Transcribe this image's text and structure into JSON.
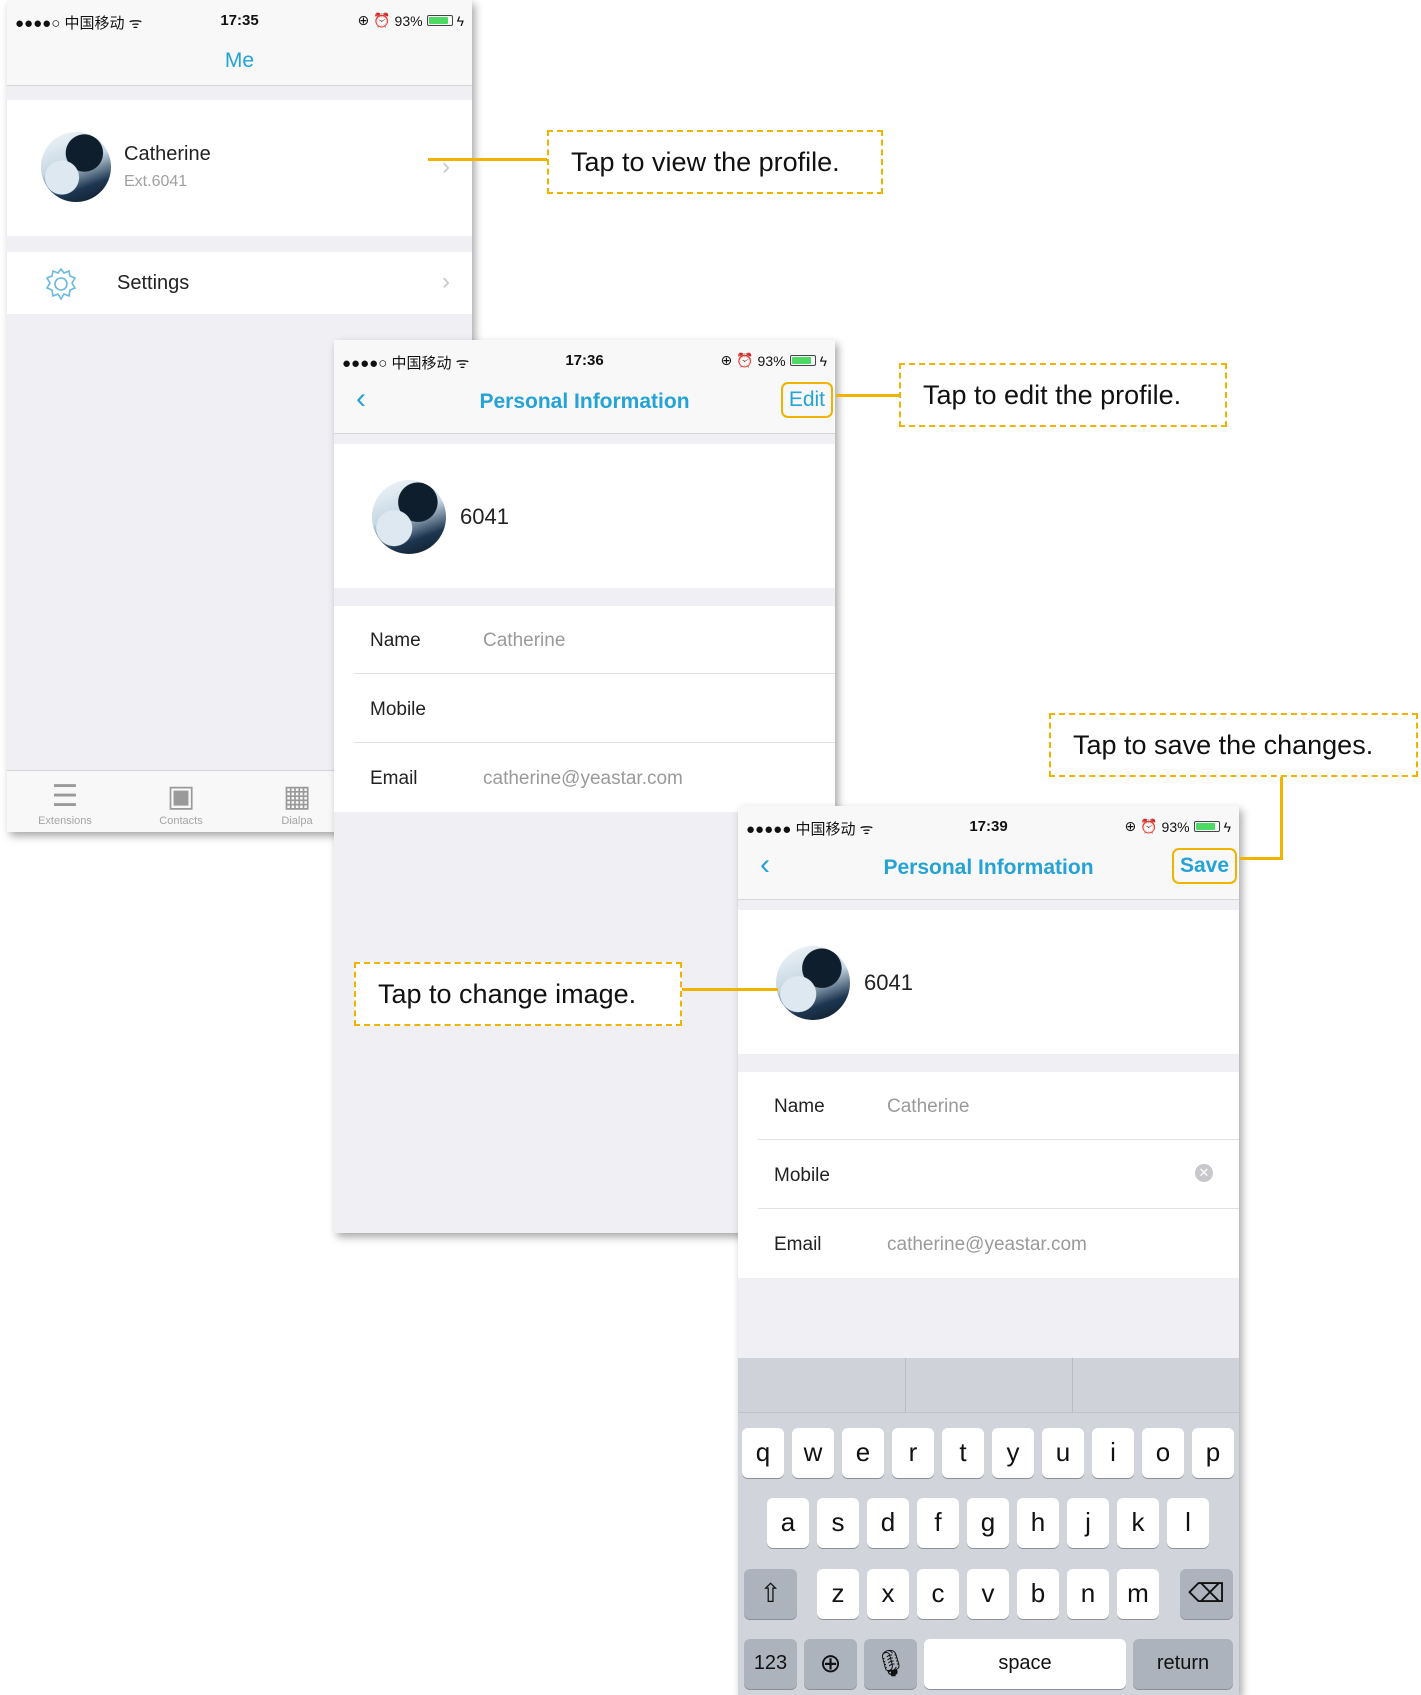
{
  "screen1": {
    "status": {
      "carrier": "●●●●○ 中国移动 ᯤ",
      "time": "17:35",
      "icons": "⊕ ⏰",
      "battery": "93%"
    },
    "title": "Me",
    "profile": {
      "name": "Catherine",
      "ext": "Ext.6041"
    },
    "settings_label": "Settings",
    "tabs": [
      {
        "label": "Extensions",
        "icon": "list-icon"
      },
      {
        "label": "Contacts",
        "icon": "contacts-icon"
      },
      {
        "label": "Dialpa",
        "icon": "dialpad-icon"
      }
    ]
  },
  "screen2": {
    "status": {
      "carrier": "●●●●○ 中国移动 ᯤ",
      "time": "17:36",
      "icons": "⊕ ⏰",
      "battery": "93%"
    },
    "title": "Personal Information",
    "action": "Edit",
    "extension": "6041",
    "fields": [
      {
        "label": "Name",
        "value": "Catherine"
      },
      {
        "label": "Mobile",
        "value": ""
      },
      {
        "label": "Email",
        "value": "catherine@yeastar.com"
      }
    ]
  },
  "screen3": {
    "status": {
      "carrier": "●●●●● 中国移动 ᯤ",
      "time": "17:39",
      "icons": "⊕ ⏰",
      "battery": "93%"
    },
    "title": "Personal Information",
    "action": "Save",
    "extension": "6041",
    "fields": [
      {
        "label": "Name",
        "value": "Catherine"
      },
      {
        "label": "Mobile",
        "value": ""
      },
      {
        "label": "Email",
        "value": "catherine@yeastar.com"
      }
    ],
    "keyboard": {
      "row1": [
        "q",
        "w",
        "e",
        "r",
        "t",
        "y",
        "u",
        "i",
        "o",
        "p"
      ],
      "row2": [
        "a",
        "s",
        "d",
        "f",
        "g",
        "h",
        "j",
        "k",
        "l"
      ],
      "row3": [
        "z",
        "x",
        "c",
        "v",
        "b",
        "n",
        "m"
      ],
      "numbers": "123",
      "space": "space",
      "return": "return"
    }
  },
  "callouts": {
    "view_profile": "Tap to view the profile.",
    "edit_profile": "Tap to edit the profile.",
    "save_changes": "Tap to save the changes.",
    "change_image": "Tap to change image."
  },
  "colors": {
    "accent": "#25a3d6",
    "highlight": "#f0b400"
  }
}
